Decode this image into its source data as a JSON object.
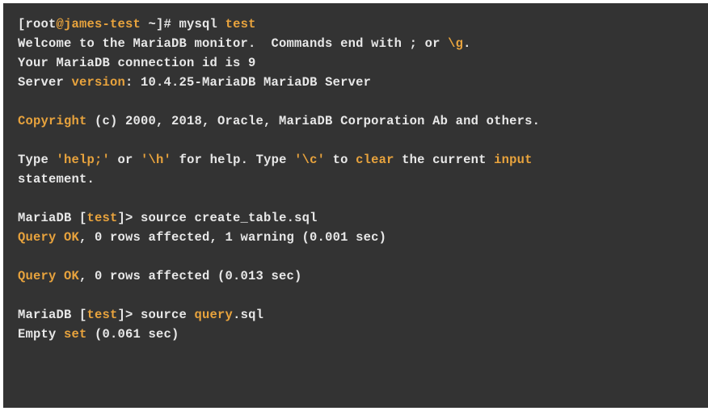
{
  "line1": {
    "prompt_open": "[root",
    "at": "@james-test",
    "tilde": " ~]# mysql ",
    "cmd": "test"
  },
  "line2": {
    "a": "Welcome to the MariaDB monitor.  Commands end with ; or ",
    "b": "\\g",
    "c": "."
  },
  "line3": "Your MariaDB connection id is 9",
  "line4": {
    "a": "Server ",
    "b": "version",
    "c": ": 10.4.25-MariaDB MariaDB Server"
  },
  "line5": {
    "a": "Copyright",
    "b": " (c) 2000, 2018, Oracle, MariaDB Corporation Ab and others."
  },
  "line6": {
    "a": "Type ",
    "b": "'help;'",
    "c": " or ",
    "d": "'\\h'",
    "e": " for help",
    "f": ". Type ",
    "g": "'\\c'",
    "h": " to ",
    "i": "clear",
    "j": " the current ",
    "k": "input"
  },
  "line7": "statement.",
  "line8": {
    "a": "MariaDB [",
    "b": "test",
    "c": "]> source create_table.sql"
  },
  "line9": {
    "a": "Query OK",
    "b": ", 0 rows affected, 1 warning (0.001 sec)"
  },
  "line10": {
    "a": "Query OK",
    "b": ", 0 rows affected (0.013 sec)"
  },
  "line11": {
    "a": "MariaDB [",
    "b": "test",
    "c": "]> source ",
    "d": "query",
    "e": ".sql"
  },
  "line12": {
    "a": "Empty ",
    "b": "set",
    "c": " (0.061 sec)"
  }
}
